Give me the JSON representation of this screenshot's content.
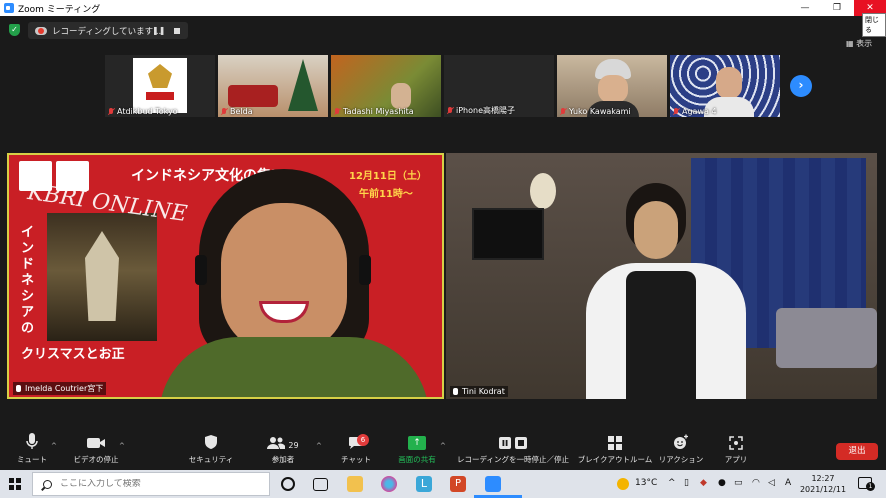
{
  "window": {
    "title": "Zoom ミーティング",
    "minimize": "—",
    "maximize": "❐",
    "close": "✕",
    "close_tooltip": "閉じる"
  },
  "topbar": {
    "recording_status": "レコーディングしています...",
    "pause": "❚❚",
    "view_label": "表示"
  },
  "thumbnails": [
    {
      "name": "Atdikbud Tokyo",
      "bg": "#e9e9e9",
      "logo_text": "KBRI TOKYO"
    },
    {
      "name": "Belda",
      "bg": "#d9c8b4"
    },
    {
      "name": "Tadashi Miyashita",
      "bg": "#7b5a36"
    },
    {
      "name": "iPhone高橋陽子",
      "bg": "#262626"
    },
    {
      "name": "Yuko Kawakami",
      "bg": "#b9a58d"
    },
    {
      "name": "Agawa 4",
      "bg": "#2a3c7a"
    }
  ],
  "next_page": "›",
  "main_videos": {
    "left": {
      "name": "Imelda Coutrier宮下",
      "banner_title": "インドネシア文化の集い",
      "banner_date": "12月11日（土）",
      "banner_time": "午前11時～",
      "banner_online": "KBRI ONLINE",
      "banner_vertical": "インドネシアの",
      "banner_bottom": "クリスマスとお正"
    },
    "right": {
      "name": "Tini Kodrat"
    }
  },
  "toolbar": {
    "mute": "ミュート",
    "video_stop": "ビデオの停止",
    "security": "セキュリティ",
    "participants": "参加者",
    "participants_count": "29",
    "chat": "チャット",
    "chat_badge": "6",
    "share": "画面の共有",
    "recording_pause_stop": "レコーディングを一時停止／停止",
    "breakout": "ブレイクアウトルーム",
    "reaction": "リアクション",
    "apps": "アプリ",
    "end": "退出"
  },
  "taskbar": {
    "search_placeholder": "ここに入力して検索",
    "temperature": "13°C",
    "ime": "A",
    "time": "12:27",
    "date": "2021/12/11",
    "notification_count": "1"
  },
  "colors": {
    "zoom_blue": "#2D8CFF",
    "end_red": "#d42b25",
    "active_speaker_border": "#d7d046",
    "share_green": "#23b14d"
  }
}
